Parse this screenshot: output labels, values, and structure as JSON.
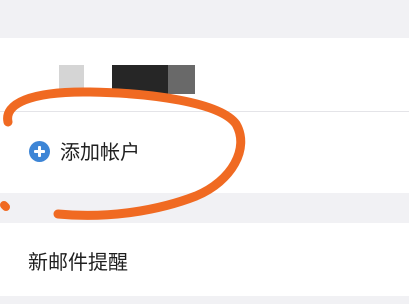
{
  "settings": {
    "add_account": {
      "label": "添加帐户",
      "icon": "plus-circle-icon",
      "icon_color": "#3d85d6"
    },
    "new_mail_reminder": {
      "label": "新邮件提醒"
    }
  },
  "annotation": {
    "stroke_color": "#f06a22"
  }
}
